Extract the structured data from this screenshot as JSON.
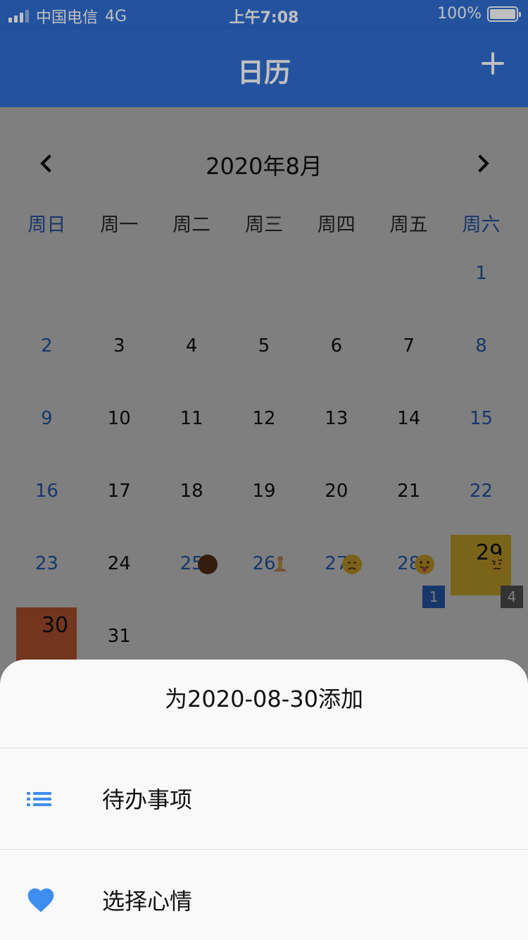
{
  "status_bar": {
    "carrier": "中国电信",
    "network": "4G",
    "time": "上午7:08",
    "battery": "100%"
  },
  "app_bar": {
    "title": "日历",
    "add_icon": "plus-icon"
  },
  "calendar": {
    "month_title": "2020年8月",
    "prev_icon": "chevron-left-icon",
    "next_icon": "chevron-right-icon",
    "weekdays": [
      "周日",
      "周一",
      "周二",
      "周三",
      "周四",
      "周五",
      "周六"
    ],
    "days": {
      "d1": "1",
      "d2": "2",
      "d3": "3",
      "d4": "4",
      "d5": "5",
      "d6": "6",
      "d7": "7",
      "d8": "8",
      "d9": "9",
      "d10": "10",
      "d11": "11",
      "d12": "12",
      "d13": "13",
      "d14": "14",
      "d15": "15",
      "d16": "16",
      "d17": "17",
      "d18": "18",
      "d19": "19",
      "d20": "20",
      "d21": "21",
      "d22": "22",
      "d23": "23",
      "d24": "24",
      "d25": "25",
      "d26": "26",
      "d27": "27",
      "d28": "28",
      "d29": "29",
      "d30": "30",
      "d31": "31"
    },
    "badges": {
      "d28": "1",
      "d29": "4"
    },
    "colors": {
      "accent": "#2f6fd5",
      "highlight_29": "#f2c933",
      "highlight_30": "#e96b3f"
    }
  },
  "sheet": {
    "title": "为2020-08-30添加",
    "items": [
      {
        "label": "待办事项",
        "icon": "list-icon"
      },
      {
        "label": "选择心情",
        "icon": "heart-icon"
      }
    ]
  }
}
